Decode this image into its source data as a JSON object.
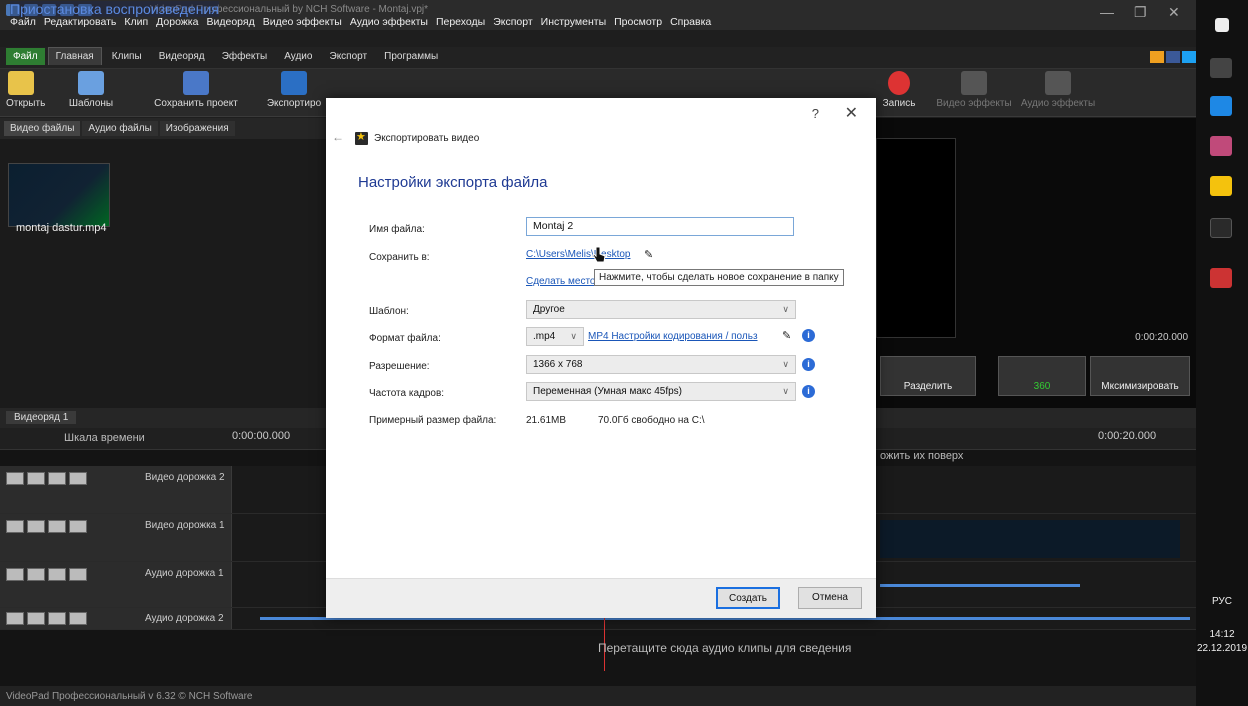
{
  "window": {
    "title": "VideoPad Профессиональный by NCH Software - Montaj.vpj*",
    "overlay_tag": "Приостановка воспроизведения"
  },
  "menu": [
    "Файл",
    "Редактировать",
    "Клип",
    "Дорожка",
    "Видеоряд",
    "Видео эффекты",
    "Аудио эффекты",
    "Переходы",
    "Экспорт",
    "Инструменты",
    "Просмотр",
    "Справка"
  ],
  "ribbon_tabs": [
    "Файл",
    "Главная",
    "Клипы",
    "Видеоряд",
    "Эффекты",
    "Аудио",
    "Экспорт",
    "Программы"
  ],
  "ribbon": {
    "open": "Открыть",
    "templates": "Шаблоны",
    "save_project": "Сохранить проект",
    "export": "Экспортиро",
    "record": "Запись",
    "video_effects": "Видео эффекты",
    "audio_effects": "Аудио эффекты"
  },
  "bins": {
    "tabs": [
      "Видео файлы",
      "Аудио файлы",
      "Изображения"
    ],
    "clip_name": "montaj dastur.mp4"
  },
  "preview": {
    "time": "0:00:20.000",
    "split": "Разделить",
    "b360": "360",
    "maximize": "Мксимизировать"
  },
  "timeline": {
    "tab": "Видеоряд 1",
    "ruler_label": "Шкала времени",
    "time_start": "0:00:00.000",
    "time_end": "0:00:20.000",
    "overlay_hint": "ожить их поверх",
    "tracks": [
      "Видео дорожка 2",
      "Видео дорожка 1",
      "Аудио дорожка 1",
      "Аудио дорожка 2"
    ],
    "drop_hint": "Перетащите сюда аудио клипы для сведения"
  },
  "status": "VideoPad Профессиональный v 6.32 © NCH Software",
  "taskbar": {
    "lang": "РУС",
    "time": "14:12",
    "date": "22.12.2019"
  },
  "dialog": {
    "title": "Экспортировать видео",
    "heading": "Настройки экспорта файла",
    "help": "?",
    "close": "✕",
    "labels": {
      "filename": "Имя файла:",
      "save_to": "Сохранить в:",
      "template": "Шаблон:",
      "format": "Формат файла:",
      "resolution": "Разрешение:",
      "framerate": "Частота кадров:",
      "size": "Примерный размер файла:"
    },
    "filename_value": "Montaj 2",
    "save_path": "C:\\Users\\Melis\\Desktop",
    "make_folder_link": "Сделать место",
    "tooltip": "Нажмите, чтобы сделать новое сохранение в папку",
    "template_value": "Другое",
    "format_value": ".mp4",
    "format_settings_link": "MP4 Настройки кодирования / польз",
    "resolution_value": "1366 x 768",
    "framerate_value": "Переменная (Умная макс 45fps)",
    "size_value": "21.61MB",
    "free_value": "70.0Гб свободно на C:\\",
    "create": "Создать",
    "cancel": "Отмена"
  }
}
